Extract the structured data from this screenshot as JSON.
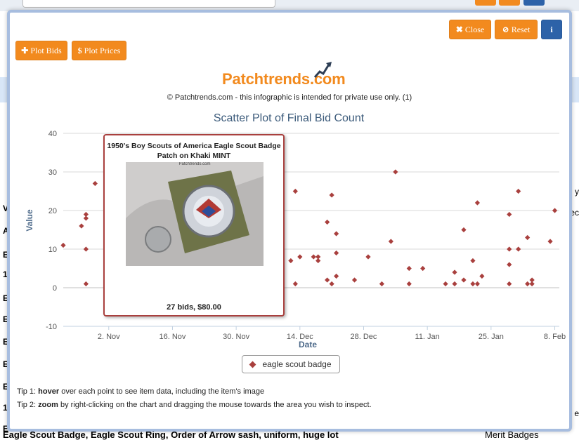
{
  "background": {
    "bottom_left_text": "Eagle Scout Badge, Eagle Scout Ring, Order of Arrow sash, uniform, huge lot",
    "bottom_right_text": "Merit Badges",
    "left_letters": [
      "V",
      "A",
      "E",
      "1",
      "E",
      "E",
      "E",
      "E",
      "E",
      "1",
      "E"
    ],
    "right_letters": [
      "y",
      "ec",
      "e"
    ]
  },
  "toolbar": {
    "close_label": "Close",
    "reset_label": "Reset",
    "info_label": "i",
    "plot_bids_label": "Plot Bids",
    "plot_prices_label": "Plot Prices"
  },
  "header": {
    "logo_text": "Patchtrends.com",
    "copyright": "© Patchtrends.com - this infographic is intended for private use only. (1)"
  },
  "colors": {
    "orange": "#f28a1e",
    "blue": "#2d62a8",
    "marker": "#a9403e",
    "title": "#3b5a7a"
  },
  "tooltip": {
    "title": "1950's Boy Scouts of America Eagle Scout Badge Patch on Khaki MINT",
    "caption": "27 bids, $80.00",
    "image_watermark": "Patchtrends.com"
  },
  "tips": {
    "tip1_prefix": "Tip 1: ",
    "tip1_bold": "hover",
    "tip1_rest": " over each point to see item data, including the item's image",
    "tip2_prefix": "Tip 2: ",
    "tip2_bold": "zoom",
    "tip2_rest": " by right-clicking on the chart and dragging the mouse towards the area you wish to inspect."
  },
  "chart_data": {
    "type": "scatter",
    "title": "Scatter Plot of Final Bid Count",
    "xlabel": "Date",
    "ylabel": "Value",
    "ylim": [
      -10,
      40
    ],
    "yticks": [
      -10,
      0,
      10,
      20,
      30,
      40
    ],
    "xticks": [
      "2. Nov",
      "16. Nov",
      "30. Nov",
      "14. Dec",
      "28. Dec",
      "11. Jan",
      "25. Jan",
      "8. Feb"
    ],
    "xlim": [
      "2015-10-23",
      "2016-02-09"
    ],
    "legend": "bottom-center",
    "series": [
      {
        "name": "eagle scout badge",
        "points": [
          [
            "2015-10-23",
            11
          ],
          [
            "2015-10-27",
            16
          ],
          [
            "2015-10-28",
            19
          ],
          [
            "2015-10-28",
            18
          ],
          [
            "2015-10-28",
            10
          ],
          [
            "2015-10-28",
            1
          ],
          [
            "2015-10-30",
            27
          ],
          [
            "2015-11-02",
            5
          ],
          [
            "2015-11-03",
            6
          ],
          [
            "2015-11-04",
            18
          ],
          [
            "2015-11-04",
            9
          ],
          [
            "2015-11-05",
            15
          ],
          [
            "2015-11-06",
            2
          ],
          [
            "2015-11-06",
            1
          ],
          [
            "2015-11-08",
            1
          ],
          [
            "2015-11-10",
            5
          ],
          [
            "2015-11-12",
            3
          ],
          [
            "2015-11-14",
            1
          ],
          [
            "2015-11-16",
            2
          ],
          [
            "2015-11-18",
            4
          ],
          [
            "2015-11-20",
            3
          ],
          [
            "2015-11-22",
            1
          ],
          [
            "2015-11-25",
            2
          ],
          [
            "2015-11-27",
            1
          ],
          [
            "2015-12-03",
            2
          ],
          [
            "2015-12-05",
            1
          ],
          [
            "2015-12-09",
            7
          ],
          [
            "2015-12-12",
            7
          ],
          [
            "2015-12-13",
            1
          ],
          [
            "2015-12-13",
            25
          ],
          [
            "2015-12-14",
            8
          ],
          [
            "2015-12-17",
            8
          ],
          [
            "2015-12-18",
            7
          ],
          [
            "2015-12-18",
            8
          ],
          [
            "2015-12-20",
            2
          ],
          [
            "2015-12-20",
            17
          ],
          [
            "2015-12-21",
            24
          ],
          [
            "2015-12-21",
            1
          ],
          [
            "2015-12-22",
            14
          ],
          [
            "2015-12-22",
            9
          ],
          [
            "2015-12-22",
            3
          ],
          [
            "2015-12-26",
            2
          ],
          [
            "2015-12-29",
            8
          ],
          [
            "2016-01-01",
            1
          ],
          [
            "2016-01-03",
            12
          ],
          [
            "2016-01-04",
            30
          ],
          [
            "2016-01-07",
            5
          ],
          [
            "2016-01-07",
            1
          ],
          [
            "2016-01-10",
            5
          ],
          [
            "2016-01-15",
            1
          ],
          [
            "2016-01-17",
            4
          ],
          [
            "2016-01-17",
            1
          ],
          [
            "2016-01-19",
            15
          ],
          [
            "2016-01-19",
            2
          ],
          [
            "2016-01-21",
            7
          ],
          [
            "2016-01-21",
            1
          ],
          [
            "2016-01-22",
            22
          ],
          [
            "2016-01-22",
            1
          ],
          [
            "2016-01-23",
            3
          ],
          [
            "2016-01-29",
            19
          ],
          [
            "2016-01-29",
            10
          ],
          [
            "2016-01-29",
            6
          ],
          [
            "2016-01-29",
            1
          ],
          [
            "2016-01-31",
            25
          ],
          [
            "2016-01-31",
            10
          ],
          [
            "2016-02-02",
            13
          ],
          [
            "2016-02-02",
            1
          ],
          [
            "2016-02-03",
            2
          ],
          [
            "2016-02-03",
            1
          ],
          [
            "2016-02-07",
            12
          ],
          [
            "2016-02-08",
            20
          ]
        ]
      }
    ]
  }
}
